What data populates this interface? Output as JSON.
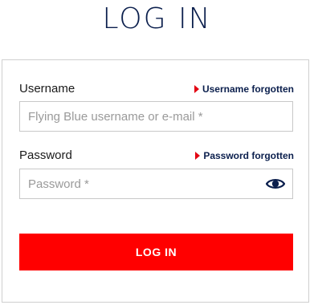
{
  "header": {
    "title": "LOG IN"
  },
  "form": {
    "username": {
      "label": "Username",
      "forgot_label": "Username forgotten",
      "placeholder": "Flying Blue username or e-mail *",
      "value": ""
    },
    "password": {
      "label": "Password",
      "forgot_label": "Password forgotten",
      "placeholder": "Password *",
      "value": "",
      "toggle_icon": "eye-icon"
    },
    "submit_label": "LOG IN"
  },
  "colors": {
    "brand_navy": "#0b1f4d",
    "accent_red": "#ff0000",
    "arrow_red": "#e30613",
    "border_gray": "#c8c8c8",
    "placeholder_gray": "#9a9a9a"
  }
}
